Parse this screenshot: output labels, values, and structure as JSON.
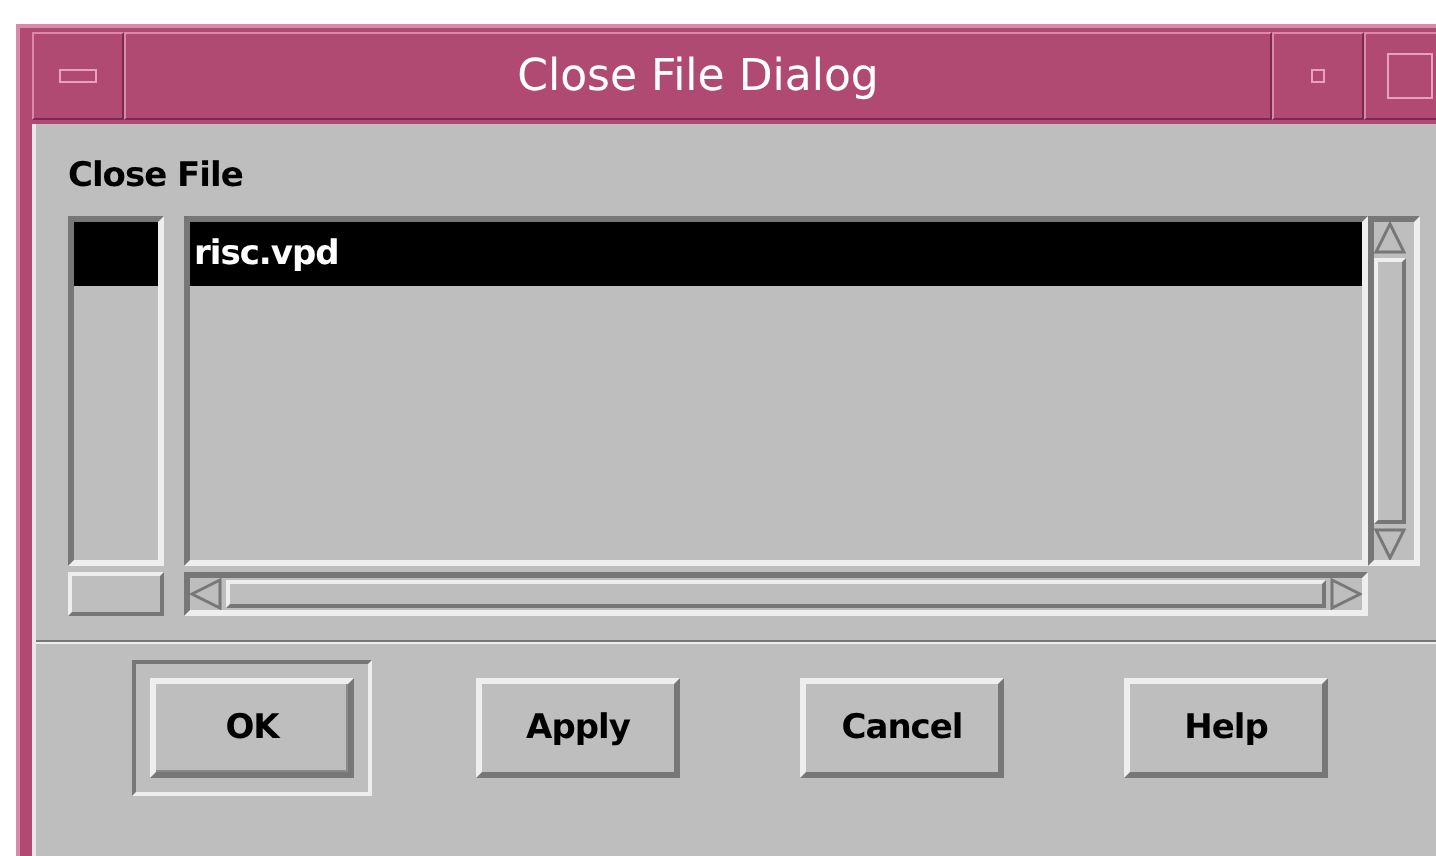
{
  "window": {
    "title": "Close File Dialog"
  },
  "label": "Close File",
  "files": [
    {
      "name": "risc.vpd",
      "selected": true
    }
  ],
  "buttons": [
    {
      "label": "OK",
      "default": true
    },
    {
      "label": "Apply",
      "default": false
    },
    {
      "label": "Cancel",
      "default": false
    },
    {
      "label": "Help",
      "default": false
    }
  ]
}
